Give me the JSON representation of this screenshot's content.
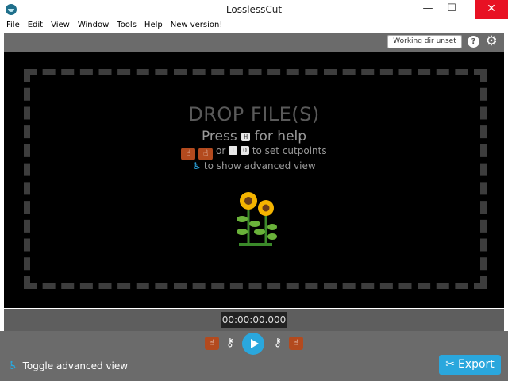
{
  "window": {
    "title": "LosslessCut",
    "minimize": "—",
    "maximize": "☐",
    "close": "✕"
  },
  "menu": [
    "File",
    "Edit",
    "View",
    "Window",
    "Tools",
    "Help",
    "New version!"
  ],
  "toolbar": {
    "working_dir": "Working dir unset",
    "help": "?",
    "settings": "⚙"
  },
  "drop": {
    "title": "DROP FILE(S)",
    "press": "Press",
    "help_key": "H",
    "for_help": "for help",
    "or": "or",
    "key_i": "I",
    "key_o": "O",
    "to_set_cutpoints": "to set cutpoints",
    "to_show_advanced": "to show advanced view",
    "illustration": "sunflower"
  },
  "timeline": {
    "timecode": "00:00:00.000"
  },
  "controls": {
    "toggle_advanced": "Toggle advanced view",
    "export": "Export"
  },
  "icons": {
    "cut_start": "hand-pointing-icon",
    "cut_end": "hand-pointing-icon",
    "key": "key-icon",
    "play": "play-icon",
    "scissors": "scissors-icon",
    "advanced": "advanced-view-icon"
  },
  "colors": {
    "accent": "#2aa7dd",
    "cut_marker": "#b34a1e",
    "close": "#e81123",
    "stage": "#000000",
    "panel": "#6b6b6b"
  }
}
